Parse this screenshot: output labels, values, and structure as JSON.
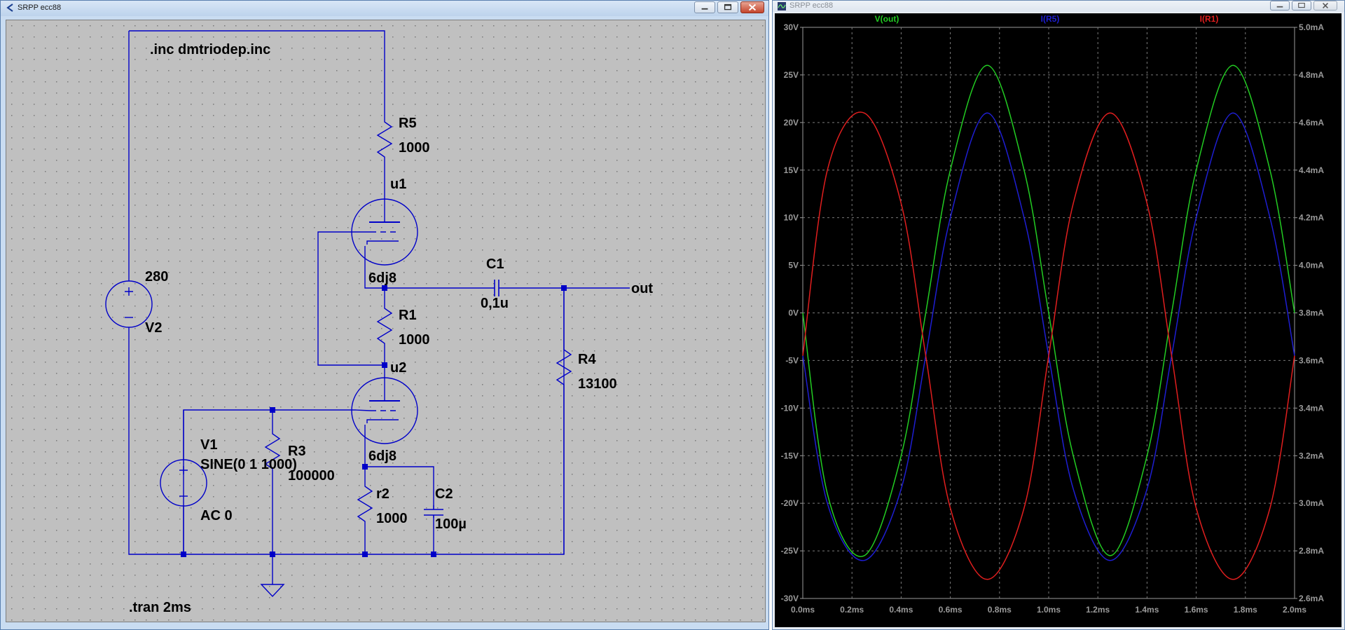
{
  "schematic_window": {
    "title": "SRPP ecc88",
    "icon": "ltspice-schematic-icon",
    "buttons": [
      "minimize-icon",
      "maximize-icon",
      "close-icon"
    ],
    "directives": {
      "include": ".inc dmtriodep.inc",
      "tran": ".tran 2ms"
    },
    "components": {
      "R5": {
        "name": "R5",
        "value": "1000"
      },
      "u1": {
        "name": "u1",
        "model": "6dj8"
      },
      "R1": {
        "name": "R1",
        "value": "1000"
      },
      "u2": {
        "name": "u2",
        "model": "6dj8"
      },
      "C1": {
        "name": "C1",
        "value": "0,1u"
      },
      "R4": {
        "name": "R4",
        "value": "13100"
      },
      "V2": {
        "name": "V2",
        "value": "280"
      },
      "V1": {
        "name": "V1",
        "value": "SINE(0 1 1000)",
        "ac": "AC 0"
      },
      "R3": {
        "name": "R3",
        "value": "100000"
      },
      "r2": {
        "name": "r2",
        "value": "1000"
      },
      "C2": {
        "name": "C2",
        "value": "100µ"
      }
    },
    "net_labels": {
      "out": "out"
    }
  },
  "waveform_window": {
    "title": "SRPP ecc88",
    "icon": "ltspice-waveform-icon",
    "buttons": [
      "minimize-icon",
      "maximize-icon",
      "close-icon"
    ]
  },
  "colors": {
    "wire": "#0000c8",
    "schematic_bg": "#c0c0c0",
    "grid_dot": "#7a7a7a",
    "plot_bg": "#000000",
    "trace_vout": "#22cc22",
    "trace_ir5": "#1e1ed2",
    "trace_ir1": "#e01e1e",
    "axis_text": "#9a9a9a"
  },
  "chart_data": {
    "type": "line",
    "xlabel": "",
    "x_ticks": [
      "0.0ms",
      "0.2ms",
      "0.4ms",
      "0.6ms",
      "0.8ms",
      "1.0ms",
      "1.2ms",
      "1.4ms",
      "1.6ms",
      "1.8ms",
      "2.0ms"
    ],
    "xlim": [
      0,
      2
    ],
    "y_left_ticks": [
      "30V",
      "25V",
      "20V",
      "15V",
      "10V",
      "5V",
      "0V",
      "-5V",
      "-10V",
      "-15V",
      "-20V",
      "-25V",
      "-30V"
    ],
    "ylim_left": [
      -30,
      30
    ],
    "y_right_ticks": [
      "5.0mA",
      "4.8mA",
      "4.6mA",
      "4.4mA",
      "4.2mA",
      "4.0mA",
      "3.8mA",
      "3.6mA",
      "3.4mA",
      "3.2mA",
      "3.0mA",
      "2.8mA",
      "2.6mA"
    ],
    "ylim_right": [
      2.6,
      5.0
    ],
    "grid": true,
    "series": [
      {
        "name": "V(out)",
        "axis": "left",
        "unit": "V",
        "x": [
          0,
          0.1,
          0.25,
          0.4,
          0.5,
          0.6,
          0.75,
          0.9,
          1.0,
          1.1,
          1.25,
          1.4,
          1.5,
          1.6,
          1.75,
          1.9,
          2.0
        ],
        "values": [
          0,
          -19,
          -25.5,
          -15,
          0,
          15,
          26,
          15,
          0,
          -15,
          -25.5,
          -15,
          0,
          15,
          26,
          15,
          0
        ]
      },
      {
        "name": "I(R5)",
        "axis": "right",
        "unit": "mA",
        "x": [
          0,
          0.1,
          0.25,
          0.4,
          0.5,
          0.6,
          0.75,
          0.9,
          1.0,
          1.1,
          1.25,
          1.4,
          1.5,
          1.6,
          1.75,
          1.9,
          2.0
        ],
        "values": [
          3.62,
          3.0,
          2.76,
          3.06,
          3.62,
          4.2,
          4.64,
          4.2,
          3.62,
          3.06,
          2.76,
          3.06,
          3.62,
          4.2,
          4.64,
          4.2,
          3.62
        ]
      },
      {
        "name": "I(R1)",
        "axis": "right",
        "unit": "mA",
        "x": [
          0,
          0.1,
          0.25,
          0.4,
          0.5,
          0.6,
          0.75,
          0.9,
          1.0,
          1.1,
          1.25,
          1.4,
          1.5,
          1.6,
          1.75,
          1.9,
          2.0
        ],
        "values": [
          3.62,
          4.4,
          4.64,
          4.26,
          3.62,
          2.98,
          2.68,
          2.98,
          3.62,
          4.26,
          4.64,
          4.26,
          3.62,
          2.98,
          2.68,
          2.98,
          3.62
        ]
      }
    ]
  }
}
